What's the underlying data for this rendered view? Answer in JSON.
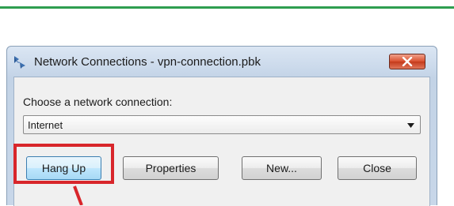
{
  "window": {
    "title": "Network Connections - vpn-connection.pbk",
    "app_icon": "network-connections-icon",
    "close_icon": "close-icon"
  },
  "dialog": {
    "prompt": "Choose a network connection:",
    "selected_connection": "Internet",
    "dropdown_icon": "chevron-down-icon"
  },
  "buttons": {
    "hang_up": "Hang Up",
    "properties": "Properties",
    "new": "New...",
    "close": "Close"
  },
  "annotation": {
    "highlight_color": "#d8262b",
    "highlighted_item": "Hang Up"
  },
  "colors": {
    "accent_rule": "#2e9e4f",
    "close_button": "#d9502f"
  }
}
